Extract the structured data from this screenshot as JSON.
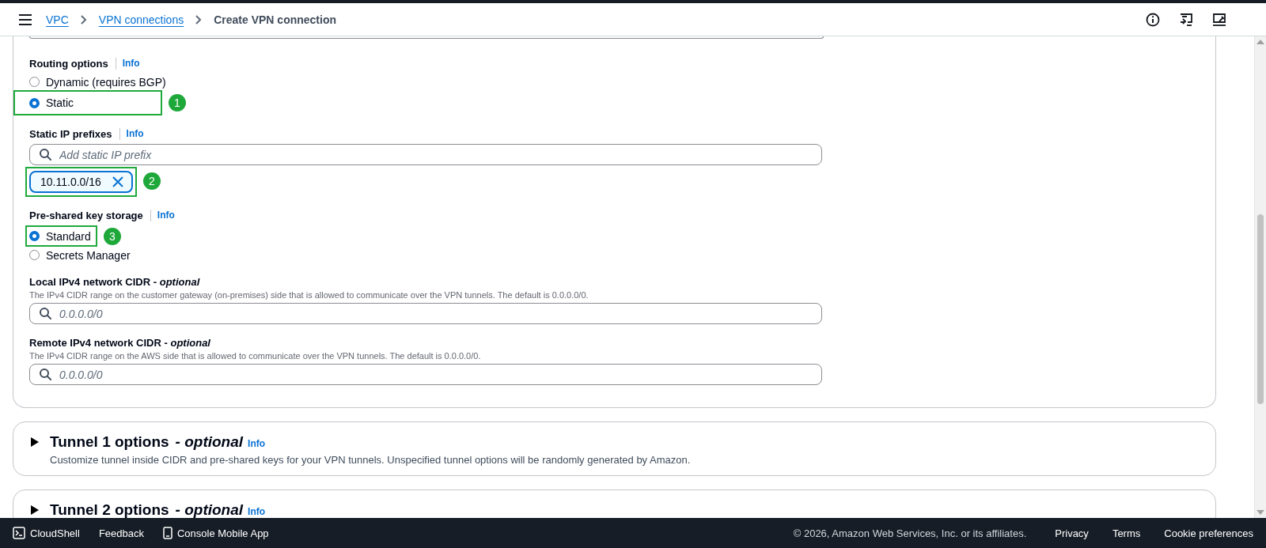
{
  "header": {
    "breadcrumbs": [
      {
        "label": "VPC",
        "link": true
      },
      {
        "label": "VPN connections",
        "link": true
      },
      {
        "label": "Create VPN connection",
        "link": false
      }
    ]
  },
  "form": {
    "sections": [
      {
        "kind": "radio",
        "label": "Routing options",
        "info": "Info",
        "options": [
          {
            "label": "Dynamic (requires BGP)",
            "selected": false
          },
          {
            "label": "Static",
            "selected": true,
            "annotation": "1"
          }
        ]
      },
      {
        "kind": "tokens",
        "label": "Static IP prefixes",
        "info": "Info",
        "placeholder": "Add static IP prefix",
        "tokens": [
          {
            "label": "10.11.0.0/16",
            "annotation": "2"
          }
        ]
      },
      {
        "kind": "radio",
        "label": "Pre-shared key storage",
        "info": "Info",
        "options": [
          {
            "label": "Standard",
            "selected": true,
            "annotation": "3"
          },
          {
            "label": "Secrets Manager",
            "selected": false
          }
        ]
      },
      {
        "kind": "search",
        "label": "Local IPv4 network CIDR - *optional*",
        "description": "The IPv4 CIDR range on the customer gateway (on-premises) side that is allowed to communicate over the VPN tunnels. The default is 0.0.0.0/0.",
        "placeholder": "0.0.0.0/0"
      },
      {
        "kind": "search",
        "label": "Remote IPv4 network CIDR - *optional*",
        "description": "The IPv4 CIDR range on the AWS side that is allowed to communicate over the VPN tunnels. The default is 0.0.0.0/0.",
        "placeholder": "0.0.0.0/0"
      }
    ]
  },
  "expanders": [
    {
      "title": "Tunnel 1 options",
      "optional": "- optional",
      "info": "Info",
      "description": "Customize tunnel inside CIDR and pre-shared keys for your VPN tunnels. Unspecified tunnel options will be randomly generated by Amazon.",
      "expanded": false
    },
    {
      "title": "Tunnel 2 options",
      "optional": "- optional",
      "info": "Info",
      "expanded": false
    }
  ],
  "footer": {
    "left": [
      {
        "kind": "cloudshell",
        "label": "CloudShell"
      },
      {
        "kind": "plain",
        "label": "Feedback"
      },
      {
        "kind": "mobile",
        "label": "Console Mobile App"
      }
    ],
    "copyright": "© 2026, Amazon Web Services, Inc. or its affiliates.",
    "links": [
      "Privacy",
      "Terms",
      "Cookie preferences"
    ]
  }
}
